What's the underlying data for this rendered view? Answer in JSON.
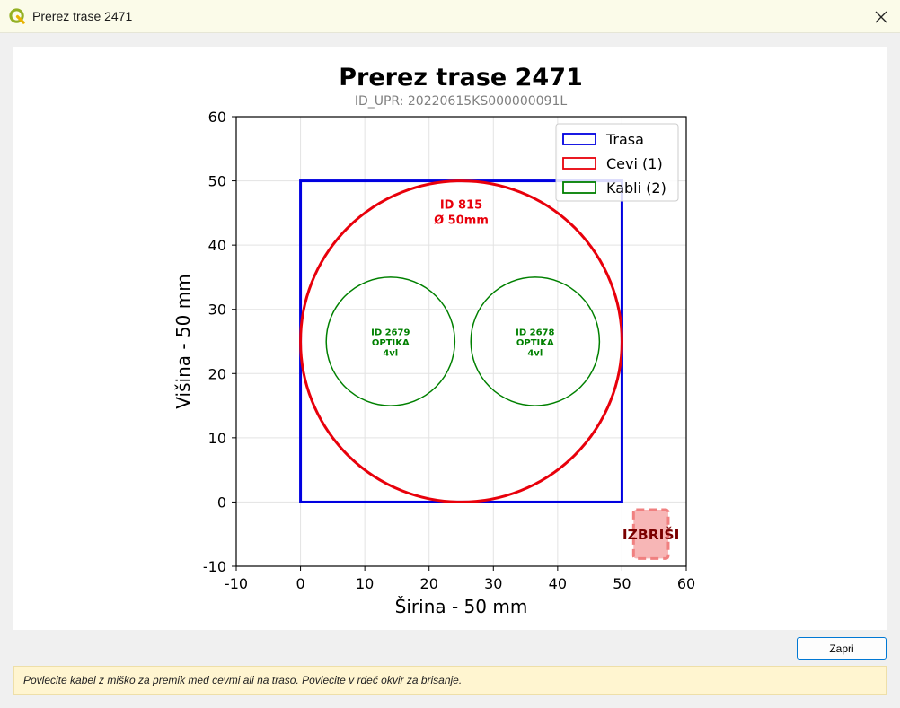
{
  "window": {
    "title": "Prerez trase 2471",
    "app_icon": "qgis-icon",
    "close_icon": "close-icon"
  },
  "chart_data": {
    "type": "scatter",
    "title": "Prerez trase 2471",
    "subtitle": "ID_UPR: 20220615KS000000091L",
    "xlabel": "Širina - 50 mm",
    "ylabel": "Višina - 50 mm",
    "xlim": [
      -10,
      60
    ],
    "ylim": [
      -10,
      60
    ],
    "xticks": [
      -10,
      0,
      10,
      20,
      30,
      40,
      50,
      60
    ],
    "yticks": [
      -10,
      0,
      10,
      20,
      30,
      40,
      50,
      60
    ],
    "grid": true,
    "legend_position": "top-right",
    "legend": [
      {
        "label": "Trasa",
        "color": "#0000e0"
      },
      {
        "label": "Cevi (1)",
        "color": "#e8000b"
      },
      {
        "label": "Kabli (2)",
        "color": "#008000"
      }
    ],
    "trasa": {
      "x0": 0,
      "y0": 0,
      "x1": 50,
      "y1": 50,
      "color": "#0000e0"
    },
    "pipes": [
      {
        "id_label": "ID 815",
        "diameter_label": "Ø 50mm",
        "cx": 25,
        "cy": 25,
        "r": 25,
        "color": "#e8000b"
      }
    ],
    "cables": [
      {
        "lines": [
          "ID 2679",
          "OPTIKA",
          "4vl"
        ],
        "cx": 14,
        "cy": 25,
        "r": 10,
        "color": "#008000"
      },
      {
        "lines": [
          "ID 2678",
          "OPTIKA",
          "4vl"
        ],
        "cx": 36.5,
        "cy": 25,
        "r": 10,
        "color": "#008000"
      }
    ],
    "delete_zone": {
      "label": "IZBRIŠI",
      "x0": 51.8,
      "y0": -8.8,
      "x1": 57.2,
      "y1": -1.2,
      "color": "#f08080"
    }
  },
  "footer": {
    "close_label": "Zapri",
    "status_text": "Povlecite kabel z miško za premik med cevmi ali na traso. Povlecite v rdeč okvir za brisanje."
  }
}
